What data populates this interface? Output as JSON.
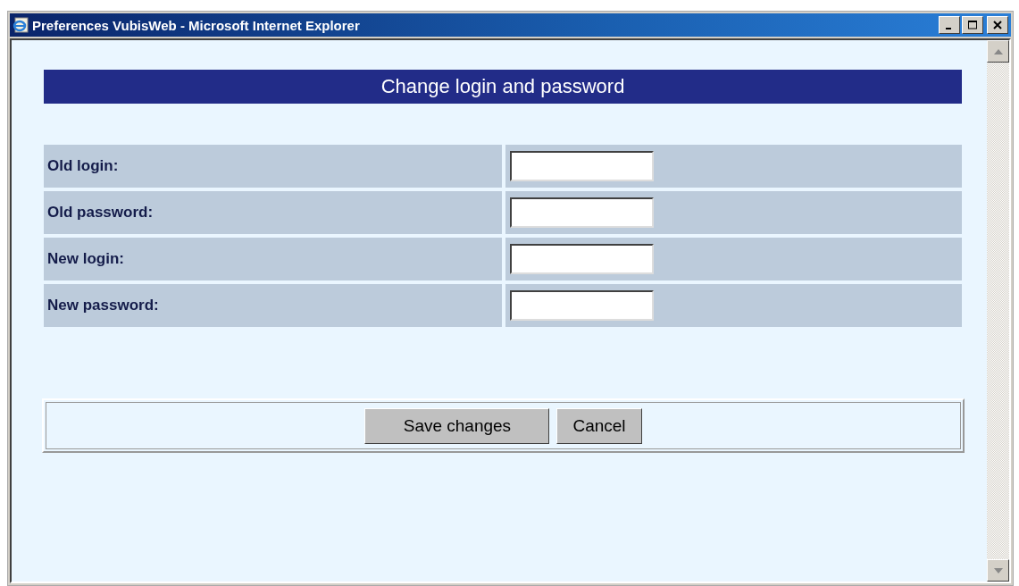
{
  "window": {
    "title": "Preferences VubisWeb - Microsoft Internet Explorer"
  },
  "heading": "Change login and password",
  "fields": [
    {
      "label": "Old login:"
    },
    {
      "label": "Old password:"
    },
    {
      "label": "New login:"
    },
    {
      "label": "New password:"
    }
  ],
  "buttons": [
    "Save changes",
    "Cancel"
  ]
}
